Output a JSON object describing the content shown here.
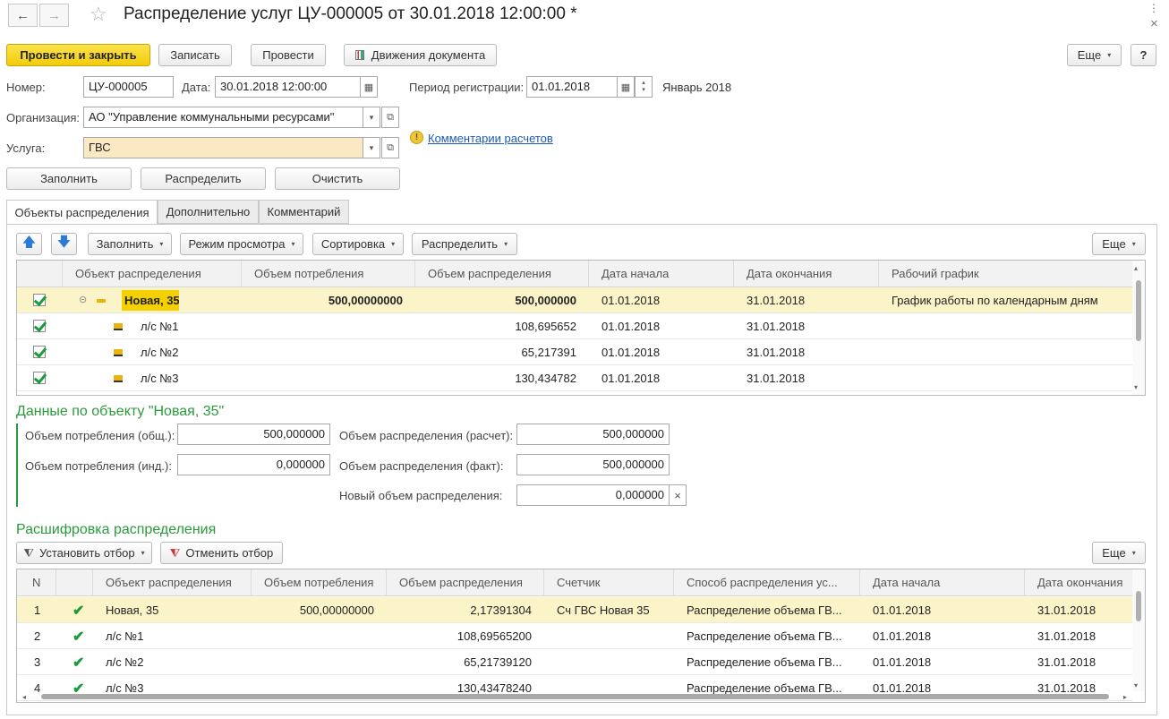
{
  "window": {
    "title": "Распределение услуг ЦУ-000005 от 30.01.2018 12:00:00 *"
  },
  "toolbar": {
    "post_close": "Провести и закрыть",
    "save": "Записать",
    "post": "Провести",
    "movements": "Движения документа",
    "more": "Еще",
    "help": "?"
  },
  "header": {
    "number_label": "Номер:",
    "number": "ЦУ-000005",
    "date_label": "Дата:",
    "date": "30.01.2018 12:00:00",
    "period_label": "Период регистрации:",
    "period": "01.01.2018",
    "period_text": "Январь 2018",
    "org_label": "Организация:",
    "org": "АО \"Управление коммунальными ресурсами\"",
    "service_label": "Услуга:",
    "service": "ГВС",
    "comments_link": "Комментарии расчетов"
  },
  "actions": {
    "fill": "Заполнить",
    "distribute": "Распределить",
    "clear": "Очистить"
  },
  "tabs": [
    "Объекты распределения",
    "Дополнительно",
    "Комментарий"
  ],
  "objects_toolbar": {
    "fill": "Заполнить",
    "view_mode": "Режим просмотра",
    "sort": "Сортировка",
    "distribute": "Распределить",
    "more": "Еще"
  },
  "objects_table": {
    "columns": [
      "Объект распределения",
      "Объем потребления",
      "Объем распределения",
      "Дата начала",
      "Дата окончания",
      "Рабочий график"
    ],
    "rows": [
      {
        "object": "Новая, 35",
        "consumption": "500,00000000",
        "distribution": "500,000000",
        "start": "01.01.2018",
        "end": "31.01.2018",
        "schedule": "График работы по календарным дням"
      },
      {
        "object": "л/с №1",
        "consumption": "",
        "distribution": "108,695652",
        "start": "01.01.2018",
        "end": "31.01.2018",
        "schedule": ""
      },
      {
        "object": "л/с №2",
        "consumption": "",
        "distribution": "65,217391",
        "start": "01.01.2018",
        "end": "31.01.2018",
        "schedule": ""
      },
      {
        "object": "л/с №3",
        "consumption": "",
        "distribution": "130,434782",
        "start": "01.01.2018",
        "end": "31.01.2018",
        "schedule": ""
      }
    ]
  },
  "object_data": {
    "title": "Данные по объекту \"Новая, 35\"",
    "cons_total_label": "Объем потребления (общ.):",
    "cons_total": "500,000000",
    "cons_ind_label": "Объем потребления (инд.):",
    "cons_ind": "0,000000",
    "dist_calc_label": "Объем распределения (расчет):",
    "dist_calc": "500,000000",
    "dist_fact_label": "Объем распределения (факт):",
    "dist_fact": "500,000000",
    "new_dist_label": "Новый объем распределения:",
    "new_dist": "0,000000",
    "clear_glyph": "×"
  },
  "breakdown": {
    "title": "Расшифровка распределения",
    "set_filter": "Установить отбор",
    "cancel_filter": "Отменить отбор",
    "more": "Еще",
    "columns": [
      "N",
      "Объект распределения",
      "Объем потребления",
      "Объем распределения",
      "Счетчик",
      "Способ распределения ус...",
      "Дата начала",
      "Дата окончания"
    ],
    "rows": [
      {
        "n": "1",
        "object": "Новая, 35",
        "consumption": "500,00000000",
        "distribution": "2,17391304",
        "meter": "Сч ГВС Новая 35",
        "method": "Распределение объема ГВ...",
        "start": "01.01.2018",
        "end": "31.01.2018"
      },
      {
        "n": "2",
        "object": "л/с №1",
        "consumption": "",
        "distribution": "108,69565200",
        "meter": "",
        "method": "Распределение объема ГВ...",
        "start": "01.01.2018",
        "end": "31.01.2018"
      },
      {
        "n": "3",
        "object": "л/с №2",
        "consumption": "",
        "distribution": "65,21739120",
        "meter": "",
        "method": "Распределение объема ГВ...",
        "start": "01.01.2018",
        "end": "31.01.2018"
      },
      {
        "n": "4",
        "object": "л/с №3",
        "consumption": "",
        "distribution": "130,43478240",
        "meter": "",
        "method": "Распределение объема ГВ...",
        "start": "01.01.2018",
        "end": "31.01.2018"
      }
    ]
  },
  "colors": {
    "accent_green": "#2a9a3c",
    "primary_button": "#f2cc0b",
    "selected_row": "#fcf4c9",
    "link": "#1c5bb5"
  }
}
